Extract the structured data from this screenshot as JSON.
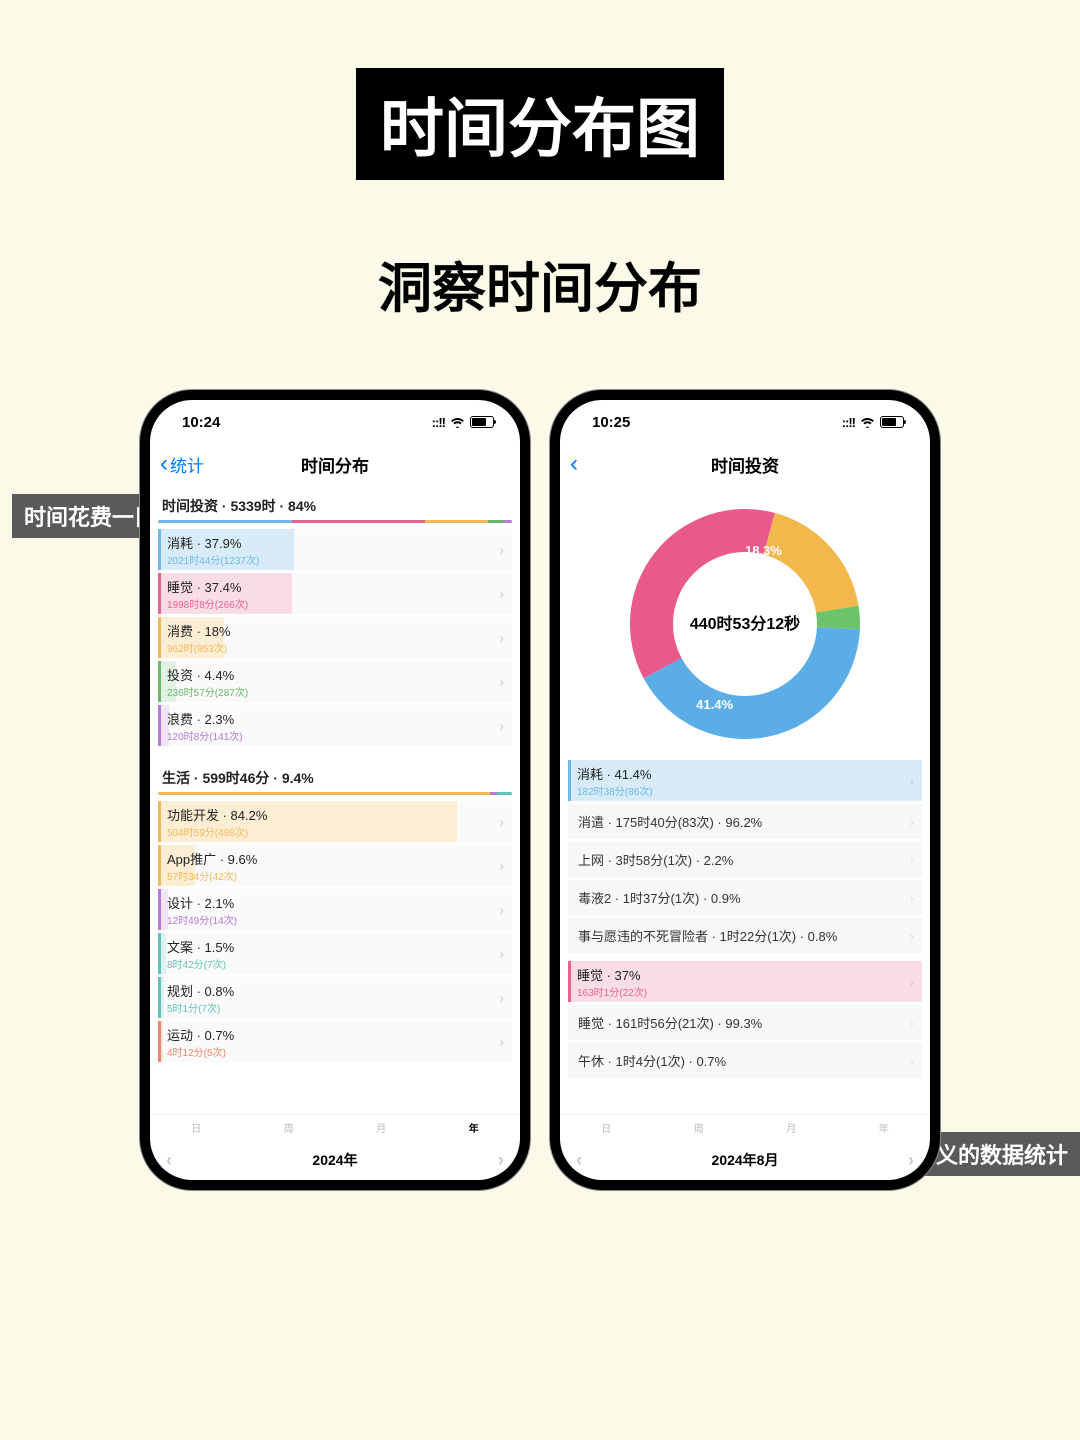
{
  "page": {
    "title_banner": "时间分布图",
    "subtitle": "洞察时间分布"
  },
  "overlays": {
    "left": "时间花费一目了然",
    "right": "每件事都会成为有意义的数据统计"
  },
  "phone_left": {
    "status_time": "10:24",
    "back_label": "统计",
    "nav_title": "时间分布",
    "section1_header": "时间投资 · 5339时 · 84%",
    "section2_header": "生活 · 599时46分 · 9.4%",
    "items1": [
      {
        "title": "消耗 · 37.9%",
        "sub": "2021时44分(1237次)",
        "color": "#6fb8e8",
        "fill": "#d7ecf8",
        "pct": 37.9
      },
      {
        "title": "睡觉 · 37.4%",
        "sub": "1998时8分(266次)",
        "color": "#e8638f",
        "fill": "#f8dde7",
        "pct": 37.4
      },
      {
        "title": "消费 · 18%",
        "sub": "962时(953次)",
        "color": "#f0b95a",
        "fill": "#fbeed4",
        "pct": 18
      },
      {
        "title": "投资 · 4.4%",
        "sub": "236时57分(287次)",
        "color": "#6bb86b",
        "fill": "#e2f2e2",
        "pct": 4.4
      },
      {
        "title": "浪费 · 2.3%",
        "sub": "120时8分(141次)",
        "color": "#b878d8",
        "fill": "#f0e4f7",
        "pct": 2.3
      }
    ],
    "items2": [
      {
        "title": "功能开发 · 84.2%",
        "sub": "504时59分(498次)",
        "color": "#f0b95a",
        "fill": "#fbeed4",
        "pct": 84.2
      },
      {
        "title": "App推广 · 9.6%",
        "sub": "57时34分(42次)",
        "color": "#f0b95a",
        "fill": "#fbeed4",
        "pct": 9.6
      },
      {
        "title": "设计 · 2.1%",
        "sub": "12时49分(14次)",
        "color": "#b878d8",
        "fill": "#f0e4f7",
        "pct": 2.1
      },
      {
        "title": "文案 · 1.5%",
        "sub": "8时42分(7次)",
        "color": "#5ec4b8",
        "fill": "#ddf3f0",
        "pct": 1.5
      },
      {
        "title": "规划 · 0.8%",
        "sub": "5时1分(7次)",
        "color": "#5ec4b8",
        "fill": "#ddf3f0",
        "pct": 0.8
      },
      {
        "title": "运动 · 0.7%",
        "sub": "4时12分(5次)",
        "color": "#e8886a",
        "fill": "#f9e5de",
        "pct": 0.7
      }
    ],
    "tabs": [
      "日",
      "周",
      "月",
      "年"
    ],
    "tab_active": 3,
    "footer_label": "2024年"
  },
  "phone_right": {
    "status_time": "10:25",
    "nav_title": "时间投资",
    "donut_center": "440时53分12秒",
    "group1": {
      "title": "消耗 · 41.4%",
      "sub": "182时38分(86次)",
      "color": "#6fb8e8",
      "fill": "#d7ecf8"
    },
    "group1_items": [
      "消遣 · 175时40分(83次) · 96.2%",
      "上网 · 3时58分(1次) · 2.2%",
      "毒液2 · 1时37分(1次) · 0.9%",
      "事与愿违的不死冒险者 · 1时22分(1次) · 0.8%"
    ],
    "group2": {
      "title": "睡觉 · 37%",
      "sub": "163时1分(22次)",
      "color": "#e8638f",
      "fill": "#f8dde7"
    },
    "group2_items": [
      "睡觉 · 161时56分(21次) · 99.3%",
      "午休 · 1时4分(1次) · 0.7%"
    ],
    "tabs": [
      "日",
      "周",
      "月",
      "年"
    ],
    "footer_label": "2024年8月"
  },
  "chart_data": {
    "type": "pie",
    "title": "时间投资",
    "center_value": "440时53分12秒",
    "series": [
      {
        "name": "消耗",
        "value": 41.4,
        "color": "#5aaee5",
        "label": "41.4%"
      },
      {
        "name": "睡觉",
        "value": 37.0,
        "color": "#e85a8c",
        "label": "37%"
      },
      {
        "name": "消费",
        "value": 18.3,
        "color": "#f2b84b",
        "label": "18.3%"
      },
      {
        "name": "投资",
        "value": 3.3,
        "color": "#6bc46b",
        "label": ""
      }
    ]
  }
}
